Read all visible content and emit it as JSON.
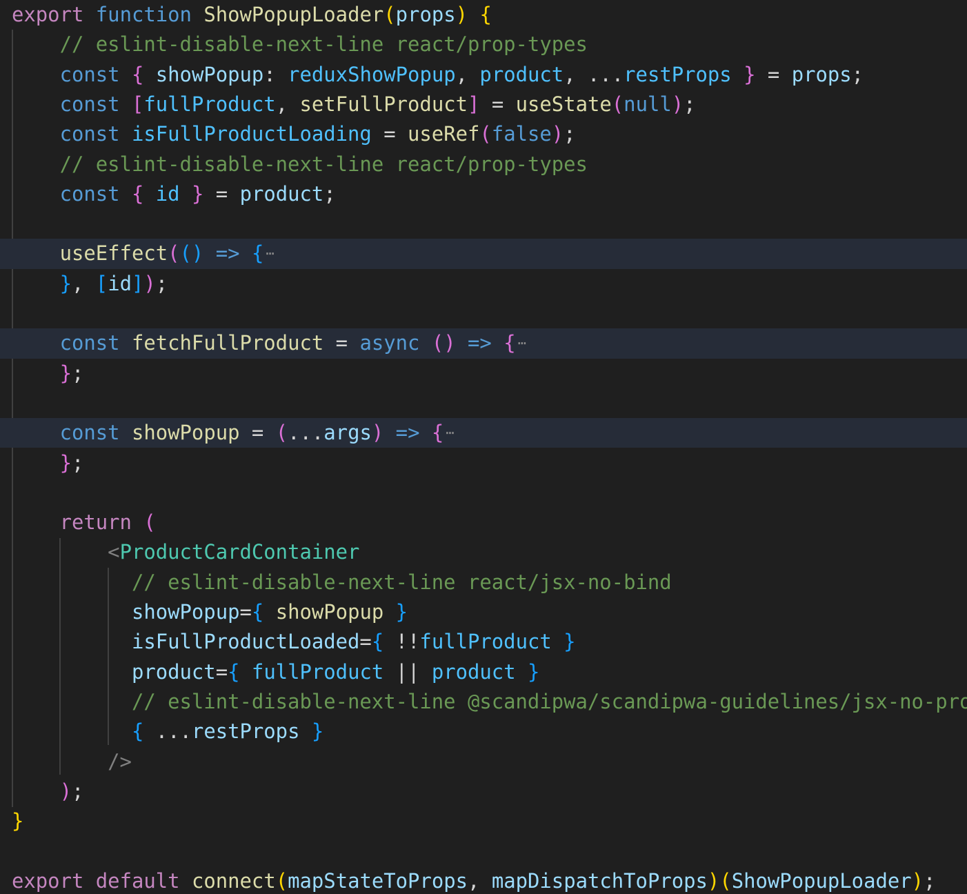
{
  "editor": {
    "theme": "dark",
    "background": "#1f1f1f",
    "folded_line_background": "#262c38",
    "lines": [
      {
        "folded": false,
        "tokens": [
          {
            "c": "kw",
            "t": "export"
          },
          {
            "c": "pu",
            "t": " "
          },
          {
            "c": "kb",
            "t": "function"
          },
          {
            "c": "pu",
            "t": " "
          },
          {
            "c": "fn",
            "t": "ShowPopupLoader"
          },
          {
            "c": "b1",
            "t": "("
          },
          {
            "c": "vr",
            "t": "props"
          },
          {
            "c": "b1",
            "t": ")"
          },
          {
            "c": "pu",
            "t": " "
          },
          {
            "c": "b1",
            "t": "{"
          }
        ]
      },
      {
        "folded": false,
        "tokens": [
          {
            "c": "pu",
            "t": "    "
          },
          {
            "c": "cm",
            "t": "// eslint-disable-next-line react/prop-types"
          }
        ]
      },
      {
        "folded": false,
        "tokens": [
          {
            "c": "pu",
            "t": "    "
          },
          {
            "c": "kb",
            "t": "const"
          },
          {
            "c": "pu",
            "t": " "
          },
          {
            "c": "b2",
            "t": "{"
          },
          {
            "c": "pu",
            "t": " "
          },
          {
            "c": "vr",
            "t": "showPopup"
          },
          {
            "c": "pu",
            "t": ": "
          },
          {
            "c": "ct",
            "t": "reduxShowPopup"
          },
          {
            "c": "pu",
            "t": ", "
          },
          {
            "c": "ct",
            "t": "product"
          },
          {
            "c": "pu",
            "t": ", ..."
          },
          {
            "c": "ct",
            "t": "restProps"
          },
          {
            "c": "pu",
            "t": " "
          },
          {
            "c": "b2",
            "t": "}"
          },
          {
            "c": "pu",
            "t": " = "
          },
          {
            "c": "vr",
            "t": "props"
          },
          {
            "c": "pu",
            "t": ";"
          }
        ]
      },
      {
        "folded": false,
        "tokens": [
          {
            "c": "pu",
            "t": "    "
          },
          {
            "c": "kb",
            "t": "const"
          },
          {
            "c": "pu",
            "t": " "
          },
          {
            "c": "b2",
            "t": "["
          },
          {
            "c": "ct",
            "t": "fullProduct"
          },
          {
            "c": "pu",
            "t": ", "
          },
          {
            "c": "fn",
            "t": "setFullProduct"
          },
          {
            "c": "b2",
            "t": "]"
          },
          {
            "c": "pu",
            "t": " = "
          },
          {
            "c": "fn",
            "t": "useState"
          },
          {
            "c": "b2",
            "t": "("
          },
          {
            "c": "kb",
            "t": "null"
          },
          {
            "c": "b2",
            "t": ")"
          },
          {
            "c": "pu",
            "t": ";"
          }
        ]
      },
      {
        "folded": false,
        "tokens": [
          {
            "c": "pu",
            "t": "    "
          },
          {
            "c": "kb",
            "t": "const"
          },
          {
            "c": "pu",
            "t": " "
          },
          {
            "c": "ct",
            "t": "isFullProductLoading"
          },
          {
            "c": "pu",
            "t": " = "
          },
          {
            "c": "fn",
            "t": "useRef"
          },
          {
            "c": "b2",
            "t": "("
          },
          {
            "c": "kb",
            "t": "false"
          },
          {
            "c": "b2",
            "t": ")"
          },
          {
            "c": "pu",
            "t": ";"
          }
        ]
      },
      {
        "folded": false,
        "tokens": [
          {
            "c": "pu",
            "t": "    "
          },
          {
            "c": "cm",
            "t": "// eslint-disable-next-line react/prop-types"
          }
        ]
      },
      {
        "folded": false,
        "tokens": [
          {
            "c": "pu",
            "t": "    "
          },
          {
            "c": "kb",
            "t": "const"
          },
          {
            "c": "pu",
            "t": " "
          },
          {
            "c": "b2",
            "t": "{"
          },
          {
            "c": "pu",
            "t": " "
          },
          {
            "c": "ct",
            "t": "id"
          },
          {
            "c": "pu",
            "t": " "
          },
          {
            "c": "b2",
            "t": "}"
          },
          {
            "c": "pu",
            "t": " = "
          },
          {
            "c": "vr",
            "t": "product"
          },
          {
            "c": "pu",
            "t": ";"
          }
        ]
      },
      {
        "folded": false,
        "tokens": []
      },
      {
        "folded": true,
        "tokens": [
          {
            "c": "pu",
            "t": "    "
          },
          {
            "c": "fn",
            "t": "useEffect"
          },
          {
            "c": "b2",
            "t": "("
          },
          {
            "c": "b3",
            "t": "()"
          },
          {
            "c": "pu",
            "t": " "
          },
          {
            "c": "kb",
            "t": "=>"
          },
          {
            "c": "pu",
            "t": " "
          },
          {
            "c": "b3",
            "t": "{"
          }
        ]
      },
      {
        "folded": false,
        "tokens": [
          {
            "c": "pu",
            "t": "    "
          },
          {
            "c": "b3",
            "t": "}"
          },
          {
            "c": "pu",
            "t": ", "
          },
          {
            "c": "b3",
            "t": "["
          },
          {
            "c": "vr",
            "t": "id"
          },
          {
            "c": "b3",
            "t": "]"
          },
          {
            "c": "b2",
            "t": ")"
          },
          {
            "c": "pu",
            "t": ";"
          }
        ]
      },
      {
        "folded": false,
        "tokens": []
      },
      {
        "folded": true,
        "tokens": [
          {
            "c": "pu",
            "t": "    "
          },
          {
            "c": "kb",
            "t": "const"
          },
          {
            "c": "pu",
            "t": " "
          },
          {
            "c": "fn",
            "t": "fetchFullProduct"
          },
          {
            "c": "pu",
            "t": " = "
          },
          {
            "c": "kb",
            "t": "async"
          },
          {
            "c": "pu",
            "t": " "
          },
          {
            "c": "b2",
            "t": "()"
          },
          {
            "c": "pu",
            "t": " "
          },
          {
            "c": "kb",
            "t": "=>"
          },
          {
            "c": "pu",
            "t": " "
          },
          {
            "c": "b2",
            "t": "{"
          }
        ]
      },
      {
        "folded": false,
        "tokens": [
          {
            "c": "pu",
            "t": "    "
          },
          {
            "c": "b2",
            "t": "}"
          },
          {
            "c": "pu",
            "t": ";"
          }
        ]
      },
      {
        "folded": false,
        "tokens": []
      },
      {
        "folded": true,
        "tokens": [
          {
            "c": "pu",
            "t": "    "
          },
          {
            "c": "kb",
            "t": "const"
          },
          {
            "c": "pu",
            "t": " "
          },
          {
            "c": "fn",
            "t": "showPopup"
          },
          {
            "c": "pu",
            "t": " = "
          },
          {
            "c": "b2",
            "t": "("
          },
          {
            "c": "pu",
            "t": "..."
          },
          {
            "c": "vr",
            "t": "args"
          },
          {
            "c": "b2",
            "t": ")"
          },
          {
            "c": "pu",
            "t": " "
          },
          {
            "c": "kb",
            "t": "=>"
          },
          {
            "c": "pu",
            "t": " "
          },
          {
            "c": "b2",
            "t": "{"
          }
        ]
      },
      {
        "folded": false,
        "tokens": [
          {
            "c": "pu",
            "t": "    "
          },
          {
            "c": "b2",
            "t": "}"
          },
          {
            "c": "pu",
            "t": ";"
          }
        ]
      },
      {
        "folded": false,
        "tokens": []
      },
      {
        "folded": false,
        "tokens": [
          {
            "c": "pu",
            "t": "    "
          },
          {
            "c": "kw",
            "t": "return"
          },
          {
            "c": "pu",
            "t": " "
          },
          {
            "c": "b2",
            "t": "("
          }
        ]
      },
      {
        "folded": false,
        "tokens": [
          {
            "c": "pu",
            "t": "        "
          },
          {
            "c": "gr",
            "t": "<"
          },
          {
            "c": "tg",
            "t": "ProductCardContainer"
          }
        ]
      },
      {
        "folded": false,
        "tokens": [
          {
            "c": "pu",
            "t": "          "
          },
          {
            "c": "cm",
            "t": "// eslint-disable-next-line react/jsx-no-bind"
          }
        ]
      },
      {
        "folded": false,
        "tokens": [
          {
            "c": "pu",
            "t": "          "
          },
          {
            "c": "vr",
            "t": "showPopup"
          },
          {
            "c": "pu",
            "t": "="
          },
          {
            "c": "b3",
            "t": "{"
          },
          {
            "c": "pu",
            "t": " "
          },
          {
            "c": "fn",
            "t": "showPopup"
          },
          {
            "c": "pu",
            "t": " "
          },
          {
            "c": "b3",
            "t": "}"
          }
        ]
      },
      {
        "folded": false,
        "tokens": [
          {
            "c": "pu",
            "t": "          "
          },
          {
            "c": "vr",
            "t": "isFullProductLoaded"
          },
          {
            "c": "pu",
            "t": "="
          },
          {
            "c": "b3",
            "t": "{"
          },
          {
            "c": "pu",
            "t": " !!"
          },
          {
            "c": "ct",
            "t": "fullProduct"
          },
          {
            "c": "pu",
            "t": " "
          },
          {
            "c": "b3",
            "t": "}"
          }
        ]
      },
      {
        "folded": false,
        "tokens": [
          {
            "c": "pu",
            "t": "          "
          },
          {
            "c": "vr",
            "t": "product"
          },
          {
            "c": "pu",
            "t": "="
          },
          {
            "c": "b3",
            "t": "{"
          },
          {
            "c": "pu",
            "t": " "
          },
          {
            "c": "ct",
            "t": "fullProduct"
          },
          {
            "c": "pu",
            "t": " || "
          },
          {
            "c": "ct",
            "t": "product"
          },
          {
            "c": "pu",
            "t": " "
          },
          {
            "c": "b3",
            "t": "}"
          }
        ]
      },
      {
        "folded": false,
        "tokens": [
          {
            "c": "pu",
            "t": "          "
          },
          {
            "c": "cm",
            "t": "// eslint-disable-next-line @scandipwa/scandipwa-guidelines/jsx-no-pro"
          }
        ]
      },
      {
        "folded": false,
        "tokens": [
          {
            "c": "pu",
            "t": "          "
          },
          {
            "c": "b3",
            "t": "{"
          },
          {
            "c": "pu",
            "t": " ..."
          },
          {
            "c": "vr",
            "t": "restProps"
          },
          {
            "c": "pu",
            "t": " "
          },
          {
            "c": "b3",
            "t": "}"
          }
        ]
      },
      {
        "folded": false,
        "tokens": [
          {
            "c": "pu",
            "t": "        "
          },
          {
            "c": "gr",
            "t": "/>"
          }
        ]
      },
      {
        "folded": false,
        "tokens": [
          {
            "c": "pu",
            "t": "    "
          },
          {
            "c": "b2",
            "t": ")"
          },
          {
            "c": "pu",
            "t": ";"
          }
        ]
      },
      {
        "folded": false,
        "tokens": [
          {
            "c": "b1",
            "t": "}"
          }
        ]
      },
      {
        "folded": false,
        "tokens": []
      },
      {
        "folded": false,
        "tokens": [
          {
            "c": "kw",
            "t": "export"
          },
          {
            "c": "pu",
            "t": " "
          },
          {
            "c": "kw",
            "t": "default"
          },
          {
            "c": "pu",
            "t": " "
          },
          {
            "c": "fn",
            "t": "connect"
          },
          {
            "c": "b1",
            "t": "("
          },
          {
            "c": "vr",
            "t": "mapStateToProps"
          },
          {
            "c": "pu",
            "t": ", "
          },
          {
            "c": "vr",
            "t": "mapDispatchToProps"
          },
          {
            "c": "b1",
            "t": ")"
          },
          {
            "c": "b1",
            "t": "("
          },
          {
            "c": "vr",
            "t": "ShowPopupLoader"
          },
          {
            "c": "b1",
            "t": ")"
          },
          {
            "c": "pu",
            "t": ";"
          }
        ]
      }
    ]
  }
}
